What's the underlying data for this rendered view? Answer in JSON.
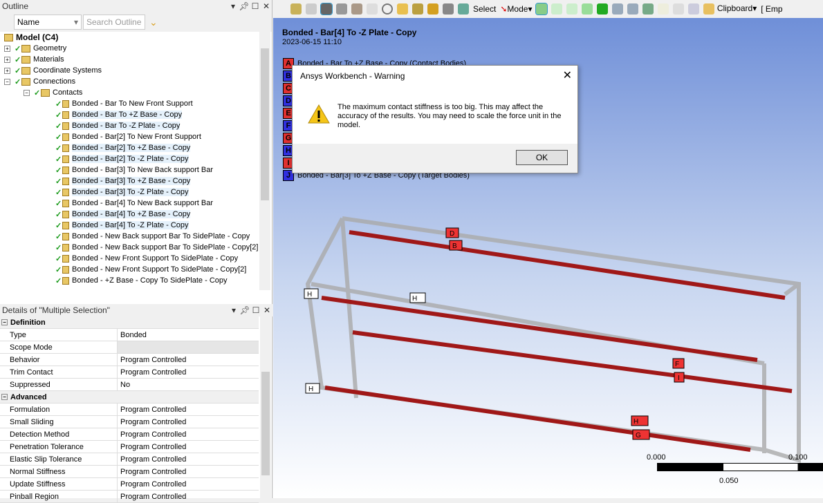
{
  "outline": {
    "title": "Outline",
    "filter_select": "Name",
    "search_placeholder": "Search Outline",
    "root": "Model (C4)",
    "nodes": [
      "Geometry",
      "Materials",
      "Coordinate Systems",
      "Connections"
    ],
    "contacts_folder": "Contacts",
    "contacts": [
      "Bonded - Bar To New Front Support",
      "Bonded - Bar To +Z Base - Copy",
      "Bonded - Bar To -Z Plate - Copy",
      "Bonded - Bar[2] To New Front Support",
      "Bonded - Bar[2] To +Z Base - Copy",
      "Bonded - Bar[2] To -Z Plate - Copy",
      "Bonded - Bar[3] To New Back support Bar",
      "Bonded - Bar[3] To +Z Base - Copy",
      "Bonded - Bar[3] To -Z Plate - Copy",
      "Bonded - Bar[4] To New Back support Bar",
      "Bonded - Bar[4] To +Z Base - Copy",
      "Bonded - Bar[4] To -Z Plate - Copy",
      "Bonded - New Back support Bar To SidePlate - Copy",
      "Bonded - New Back support Bar To SidePlate - Copy[2]",
      "Bonded - New Front Support To SidePlate - Copy",
      "Bonded - New Front Support To SidePlate - Copy[2]",
      "Bonded - +Z Base - Copy To SidePlate - Copy"
    ]
  },
  "details": {
    "title": "Details of \"Multiple Selection\"",
    "groups": [
      {
        "name": "Definition",
        "rows": [
          [
            "Type",
            "Bonded"
          ],
          [
            "Scope Mode",
            ""
          ],
          [
            "Behavior",
            "Program Controlled"
          ],
          [
            "Trim Contact",
            "Program Controlled"
          ],
          [
            "Suppressed",
            "No"
          ]
        ]
      },
      {
        "name": "Advanced",
        "rows": [
          [
            "Formulation",
            "Program Controlled"
          ],
          [
            "Small Sliding",
            "Program Controlled"
          ],
          [
            "Detection Method",
            "Program Controlled"
          ],
          [
            "Penetration Tolerance",
            "Program Controlled"
          ],
          [
            "Elastic Slip Tolerance",
            "Program Controlled"
          ],
          [
            "Normal Stiffness",
            "Program Controlled"
          ],
          [
            "Update Stiffness",
            "Program Controlled"
          ],
          [
            "Pinball Region",
            "Program Controlled"
          ]
        ]
      }
    ]
  },
  "toolbar": {
    "select": "Select",
    "mode": "Mode",
    "clipboard": "Clipboard",
    "empty": "[ Emp"
  },
  "viewport": {
    "title": "Bonded - Bar[4] To -Z Plate - Copy",
    "date": "2023-06-15 11:10",
    "legend": [
      {
        "letter": "A",
        "color": "#e03030",
        "text": "Bonded - Bar To +Z Base - Copy (Contact Bodies)"
      },
      {
        "letter": "B",
        "color": "#3030e0",
        "text": ""
      },
      {
        "letter": "C",
        "color": "#e03030",
        "text": ""
      },
      {
        "letter": "D",
        "color": "#3030e0",
        "text": ""
      },
      {
        "letter": "E",
        "color": "#e03030",
        "text": ""
      },
      {
        "letter": "F",
        "color": "#3030e0",
        "text": ""
      },
      {
        "letter": "G",
        "color": "#e03030",
        "text": ""
      },
      {
        "letter": "H",
        "color": "#3030e0",
        "text": ""
      },
      {
        "letter": "I",
        "color": "#e03030",
        "text": ""
      },
      {
        "letter": "J",
        "color": "#3030e0",
        "text": "Bonded - Bar[3] To +Z Base - Copy (Target Bodies)"
      }
    ],
    "scale": {
      "left": "0.000",
      "mid": "0.050",
      "right": "0.100"
    }
  },
  "dialog": {
    "title": "Ansys Workbench - Warning",
    "message": "The maximum contact stiffness is too big. This may affect the accuracy of the results. You may need to scale the force unit in the model.",
    "ok": "OK"
  }
}
